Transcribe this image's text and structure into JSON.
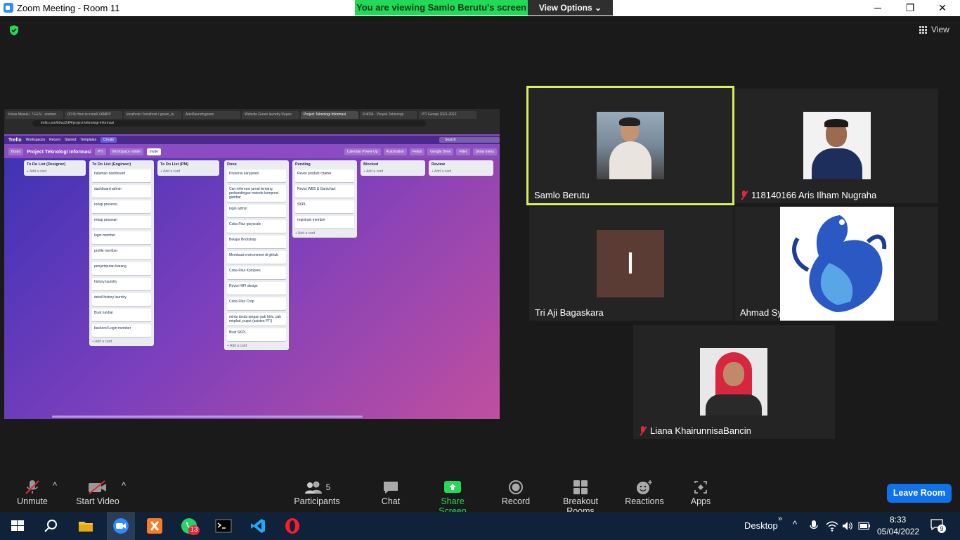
{
  "window": {
    "title": "Zoom Meeting - Room 11",
    "minimize": "─",
    "maximize": "❐",
    "close": "✕"
  },
  "share_banner": {
    "message": "You are viewing Samlo Berutu's screen",
    "view_options": "View Options"
  },
  "view_label": "View",
  "shared_screen": {
    "tabs": [
      "Kelas Masuk | 7-ELN - zoomer",
      "(974) How to install XAMPP",
      "localhost / localhost / green_la",
      "Ariel/laundrygreen",
      "Website Green laundry Repos",
      "Project Teknologi Informasi",
      "IF4034 - Proyek Teknologi",
      "PTI Genap 2021-2022"
    ],
    "url": "trello.com/b/iwz2df4/project-teknologi-informasi",
    "trello": {
      "logo": "Trello",
      "menus": [
        "Workspaces",
        "Recent",
        "Starred",
        "Templates"
      ],
      "create": "Create",
      "search": "Search"
    },
    "board": {
      "view": "Board",
      "name": "Project Teknologi Informasi",
      "workspace": "PTI",
      "visibility": "Workspace visible",
      "invite": "Invite",
      "right": [
        "Calendar Power-Up",
        "Automation",
        "Fields",
        "Google Drive",
        "Filter",
        "Show menu"
      ]
    },
    "lists": [
      {
        "title": "To Do List (Designer)",
        "cards": [],
        "add": "+ Add a card"
      },
      {
        "title": "To Do List (Engineer)",
        "cards": [
          "halaman dashboard",
          "dashboard admin",
          "rekap presensi",
          "rekap pesanan",
          "login member",
          "profile member",
          "penjemputan barang",
          "history laundry",
          "detail history laundry",
          "Buat navbar",
          "backend Login member"
        ],
        "add": "+ Add a card"
      },
      {
        "title": "To Do List (PM)",
        "cards": [],
        "add": "+ Add a card"
      },
      {
        "title": "Done",
        "cards": [
          "Presensi karyawan",
          "Cari referensi jurnal tentang perbandingan metode kompresi gambar",
          "login admin",
          "Coba Fitur gisyscale",
          "Belajar Bootstrap",
          "Membuat environment di github",
          "Coba Fitur Kompres",
          "Revisi HIFI design",
          "Coba Fitur Crop",
          "minta tanda tangan pak Idris, pak miqdad, puput (asisten PTI)",
          "Buat SKPL"
        ],
        "add": "+ Add a card"
      },
      {
        "title": "Pending",
        "cards": [
          "Revisi product charter",
          "Revisi WBS & Gantchart",
          "SKPL",
          "registrasi member"
        ],
        "add": "+ Add a card"
      },
      {
        "title": "Blocked",
        "cards": [],
        "add": "+ Add a card"
      },
      {
        "title": "Review",
        "cards": [],
        "add": "+ Add a card"
      }
    ]
  },
  "participants": [
    {
      "name": "Samlo Berutu",
      "muted": false,
      "active_speaker": true
    },
    {
      "name": "118140166 Aris Ilham Nugraha",
      "muted": true
    },
    {
      "name": "Tri Aji Bagaskara",
      "muted": false,
      "initial": "I"
    },
    {
      "name": "Ahmad Syafarudin",
      "muted": false
    },
    {
      "name": "Liana KhairunnisaBancin",
      "muted": true
    }
  ],
  "toolbar": {
    "unmute": "Unmute",
    "start_video": "Start Video",
    "participants": "Participants",
    "participant_count": "5",
    "chat": "Chat",
    "share_screen": "Share Screen",
    "record": "Record",
    "breakout_rooms": "Breakout Rooms",
    "reactions": "Reactions",
    "apps": "Apps",
    "leave": "Leave Room"
  },
  "taskbar": {
    "desktop": "Desktop",
    "time": "8:33",
    "date": "05/04/2022",
    "whatsapp_badge": "13",
    "notif_count": "9"
  },
  "colors": {
    "share_green": "#23d959",
    "active_border": "#d7ef5d",
    "leave_blue": "#0e72ed",
    "muted_red": "#e0283a"
  }
}
